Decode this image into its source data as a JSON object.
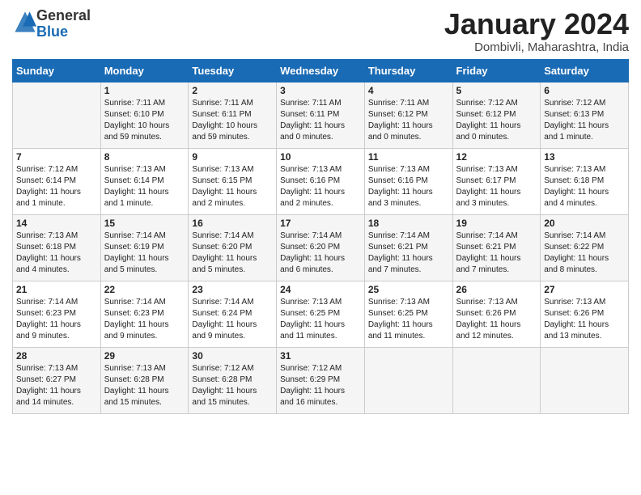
{
  "header": {
    "logo_general": "General",
    "logo_blue": "Blue",
    "month_title": "January 2024",
    "location": "Dombivli, Maharashtra, India"
  },
  "days_of_week": [
    "Sunday",
    "Monday",
    "Tuesday",
    "Wednesday",
    "Thursday",
    "Friday",
    "Saturday"
  ],
  "weeks": [
    [
      {
        "num": "",
        "info": ""
      },
      {
        "num": "1",
        "info": "Sunrise: 7:11 AM\nSunset: 6:10 PM\nDaylight: 10 hours\nand 59 minutes."
      },
      {
        "num": "2",
        "info": "Sunrise: 7:11 AM\nSunset: 6:11 PM\nDaylight: 10 hours\nand 59 minutes."
      },
      {
        "num": "3",
        "info": "Sunrise: 7:11 AM\nSunset: 6:11 PM\nDaylight: 11 hours\nand 0 minutes."
      },
      {
        "num": "4",
        "info": "Sunrise: 7:11 AM\nSunset: 6:12 PM\nDaylight: 11 hours\nand 0 minutes."
      },
      {
        "num": "5",
        "info": "Sunrise: 7:12 AM\nSunset: 6:12 PM\nDaylight: 11 hours\nand 0 minutes."
      },
      {
        "num": "6",
        "info": "Sunrise: 7:12 AM\nSunset: 6:13 PM\nDaylight: 11 hours\nand 1 minute."
      }
    ],
    [
      {
        "num": "7",
        "info": "Sunrise: 7:12 AM\nSunset: 6:14 PM\nDaylight: 11 hours\nand 1 minute."
      },
      {
        "num": "8",
        "info": "Sunrise: 7:13 AM\nSunset: 6:14 PM\nDaylight: 11 hours\nand 1 minute."
      },
      {
        "num": "9",
        "info": "Sunrise: 7:13 AM\nSunset: 6:15 PM\nDaylight: 11 hours\nand 2 minutes."
      },
      {
        "num": "10",
        "info": "Sunrise: 7:13 AM\nSunset: 6:16 PM\nDaylight: 11 hours\nand 2 minutes."
      },
      {
        "num": "11",
        "info": "Sunrise: 7:13 AM\nSunset: 6:16 PM\nDaylight: 11 hours\nand 3 minutes."
      },
      {
        "num": "12",
        "info": "Sunrise: 7:13 AM\nSunset: 6:17 PM\nDaylight: 11 hours\nand 3 minutes."
      },
      {
        "num": "13",
        "info": "Sunrise: 7:13 AM\nSunset: 6:18 PM\nDaylight: 11 hours\nand 4 minutes."
      }
    ],
    [
      {
        "num": "14",
        "info": "Sunrise: 7:13 AM\nSunset: 6:18 PM\nDaylight: 11 hours\nand 4 minutes."
      },
      {
        "num": "15",
        "info": "Sunrise: 7:14 AM\nSunset: 6:19 PM\nDaylight: 11 hours\nand 5 minutes."
      },
      {
        "num": "16",
        "info": "Sunrise: 7:14 AM\nSunset: 6:20 PM\nDaylight: 11 hours\nand 5 minutes."
      },
      {
        "num": "17",
        "info": "Sunrise: 7:14 AM\nSunset: 6:20 PM\nDaylight: 11 hours\nand 6 minutes."
      },
      {
        "num": "18",
        "info": "Sunrise: 7:14 AM\nSunset: 6:21 PM\nDaylight: 11 hours\nand 7 minutes."
      },
      {
        "num": "19",
        "info": "Sunrise: 7:14 AM\nSunset: 6:21 PM\nDaylight: 11 hours\nand 7 minutes."
      },
      {
        "num": "20",
        "info": "Sunrise: 7:14 AM\nSunset: 6:22 PM\nDaylight: 11 hours\nand 8 minutes."
      }
    ],
    [
      {
        "num": "21",
        "info": "Sunrise: 7:14 AM\nSunset: 6:23 PM\nDaylight: 11 hours\nand 9 minutes."
      },
      {
        "num": "22",
        "info": "Sunrise: 7:14 AM\nSunset: 6:23 PM\nDaylight: 11 hours\nand 9 minutes."
      },
      {
        "num": "23",
        "info": "Sunrise: 7:14 AM\nSunset: 6:24 PM\nDaylight: 11 hours\nand 9 minutes."
      },
      {
        "num": "24",
        "info": "Sunrise: 7:13 AM\nSunset: 6:25 PM\nDaylight: 11 hours\nand 11 minutes."
      },
      {
        "num": "25",
        "info": "Sunrise: 7:13 AM\nSunset: 6:25 PM\nDaylight: 11 hours\nand 11 minutes."
      },
      {
        "num": "26",
        "info": "Sunrise: 7:13 AM\nSunset: 6:26 PM\nDaylight: 11 hours\nand 12 minutes."
      },
      {
        "num": "27",
        "info": "Sunrise: 7:13 AM\nSunset: 6:26 PM\nDaylight: 11 hours\nand 13 minutes."
      }
    ],
    [
      {
        "num": "28",
        "info": "Sunrise: 7:13 AM\nSunset: 6:27 PM\nDaylight: 11 hours\nand 14 minutes."
      },
      {
        "num": "29",
        "info": "Sunrise: 7:13 AM\nSunset: 6:28 PM\nDaylight: 11 hours\nand 15 minutes."
      },
      {
        "num": "30",
        "info": "Sunrise: 7:12 AM\nSunset: 6:28 PM\nDaylight: 11 hours\nand 15 minutes."
      },
      {
        "num": "31",
        "info": "Sunrise: 7:12 AM\nSunset: 6:29 PM\nDaylight: 11 hours\nand 16 minutes."
      },
      {
        "num": "",
        "info": ""
      },
      {
        "num": "",
        "info": ""
      },
      {
        "num": "",
        "info": ""
      }
    ]
  ]
}
